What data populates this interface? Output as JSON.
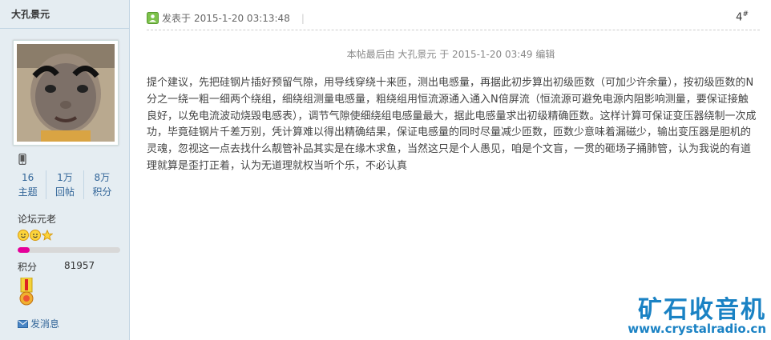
{
  "user": {
    "name": "大孔景元",
    "stats": [
      {
        "value": "16",
        "label": "主题"
      },
      {
        "value": "1万",
        "label": "回帖"
      },
      {
        "value": "8万",
        "label": "积分"
      }
    ],
    "rank": "论坛元老",
    "points_label": "积分",
    "points_value": "81957",
    "level_progress_percent": 12,
    "send_message_label": "发消息"
  },
  "post": {
    "posted_prefix": "发表于",
    "posted_time": "2015-1-20 03:13:48",
    "separator": "|",
    "floor_number": "4",
    "floor_mark": "#",
    "edited_note": "本帖最后由 大孔景元 于 2015-1-20 03:49 编辑",
    "body": "提个建议，先把硅钢片插好预留气隙，用导线穿绕十来匝，测出电感量，再据此初步算出初级匝数（可加少许余量），按初级匝数的N分之一绕一粗一细两个绕组，细绕组测量电感量，粗绕组用恒流源通入通入N倍屏流（恒流源可避免电源内阻影响测量，要保证接触良好，以免电流波动烧毁电感表），调节气隙使细绕组电感量最大，据此电感量求出初级精确匝数。这样计算可保证变压器绕制一次成功，毕竟硅钢片千差万别，凭计算难以得出精确结果，保证电感量的同时尽量减少匝数，匝数少意味着漏磁少，输出变压器是胆机的灵魂，忽视这一点去找什么靓管补品其实是在缘木求鱼，当然这只是个人愚见，咱是个文盲，一贯的砸场子捅肺管，认为我说的有道理就算是歪打正着，认为无道理就权当听个乐，不必认真"
  },
  "watermark": {
    "title": "矿石收音机",
    "url": "www.crystalradio.cn"
  },
  "colors": {
    "sidebar_bg": "#e5edf2",
    "border": "#c2d5e3",
    "link": "#336699",
    "progress": "#e5009a",
    "watermark": "#1a82c4"
  }
}
